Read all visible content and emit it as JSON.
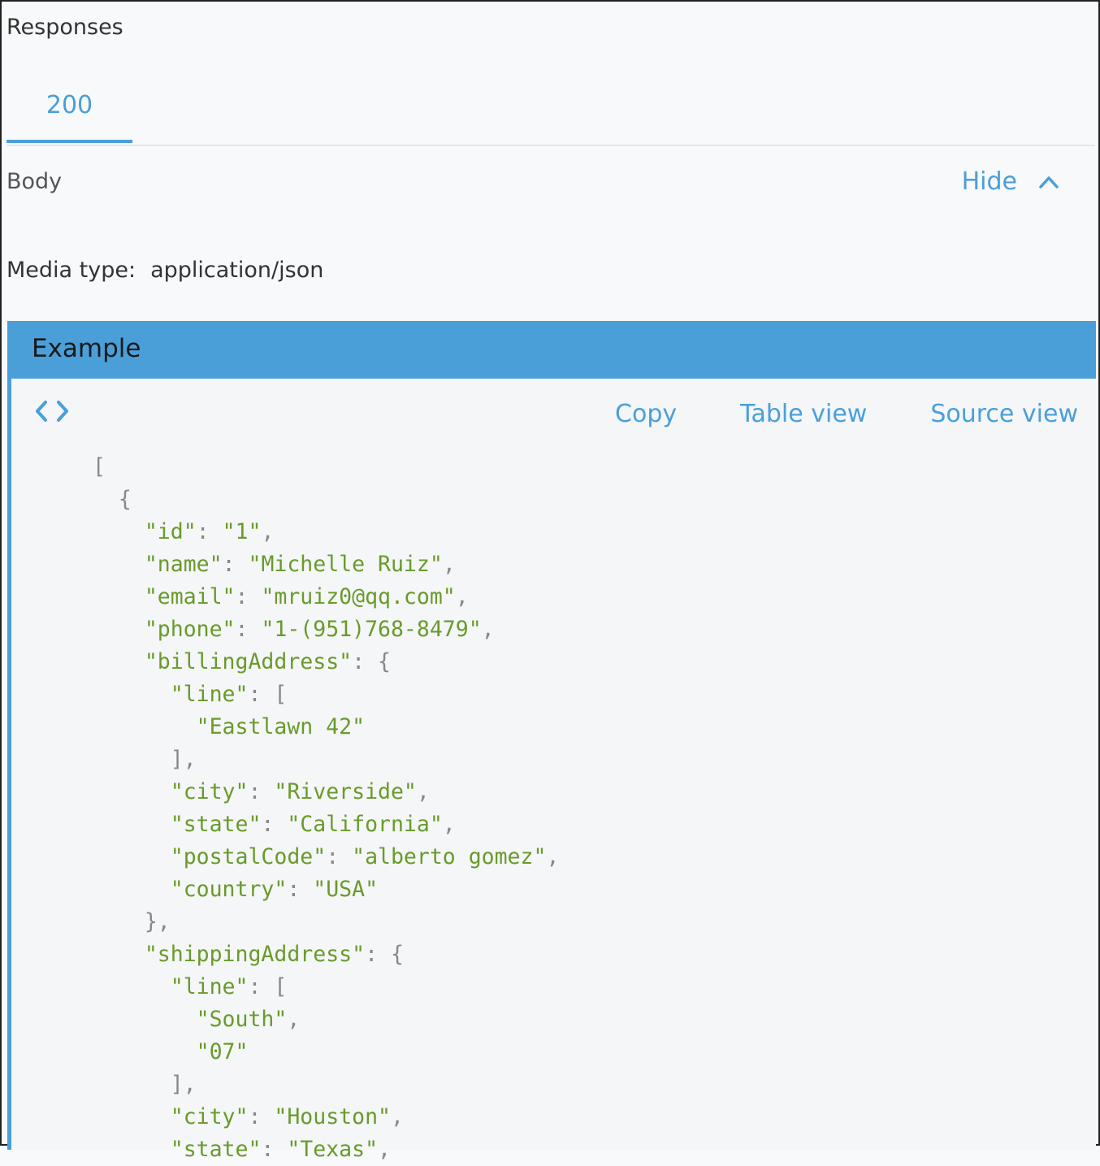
{
  "responses": {
    "title": "Responses",
    "tabs": [
      {
        "label": "200",
        "active": true
      }
    ]
  },
  "body": {
    "label": "Body",
    "toggle_label": "Hide",
    "media_type_label": "Media type:",
    "media_type_value": "application/json"
  },
  "example": {
    "title": "Example",
    "toolbar": {
      "copy": "Copy",
      "table_view": "Table view",
      "source_view": "Source view"
    },
    "code_lines": [
      [
        {
          "t": "[",
          "c": "punc"
        }
      ],
      [
        {
          "t": "  {",
          "c": "punc"
        }
      ],
      [
        {
          "t": "    ",
          "c": "punc"
        },
        {
          "t": "\"id\"",
          "c": "key"
        },
        {
          "t": ": ",
          "c": "punc"
        },
        {
          "t": "\"1\"",
          "c": "str"
        },
        {
          "t": ",",
          "c": "punc"
        }
      ],
      [
        {
          "t": "    ",
          "c": "punc"
        },
        {
          "t": "\"name\"",
          "c": "key"
        },
        {
          "t": ": ",
          "c": "punc"
        },
        {
          "t": "\"Michelle Ruiz\"",
          "c": "str"
        },
        {
          "t": ",",
          "c": "punc"
        }
      ],
      [
        {
          "t": "    ",
          "c": "punc"
        },
        {
          "t": "\"email\"",
          "c": "key"
        },
        {
          "t": ": ",
          "c": "punc"
        },
        {
          "t": "\"mruiz0@qq.com\"",
          "c": "str"
        },
        {
          "t": ",",
          "c": "punc"
        }
      ],
      [
        {
          "t": "    ",
          "c": "punc"
        },
        {
          "t": "\"phone\"",
          "c": "key"
        },
        {
          "t": ": ",
          "c": "punc"
        },
        {
          "t": "\"1-(951)768-8479\"",
          "c": "str"
        },
        {
          "t": ",",
          "c": "punc"
        }
      ],
      [
        {
          "t": "    ",
          "c": "punc"
        },
        {
          "t": "\"billingAddress\"",
          "c": "key"
        },
        {
          "t": ": {",
          "c": "punc"
        }
      ],
      [
        {
          "t": "      ",
          "c": "punc"
        },
        {
          "t": "\"line\"",
          "c": "key"
        },
        {
          "t": ": [",
          "c": "punc"
        }
      ],
      [
        {
          "t": "        ",
          "c": "punc"
        },
        {
          "t": "\"Eastlawn 42\"",
          "c": "str"
        }
      ],
      [
        {
          "t": "      ],",
          "c": "punc"
        }
      ],
      [
        {
          "t": "      ",
          "c": "punc"
        },
        {
          "t": "\"city\"",
          "c": "key"
        },
        {
          "t": ": ",
          "c": "punc"
        },
        {
          "t": "\"Riverside\"",
          "c": "str"
        },
        {
          "t": ",",
          "c": "punc"
        }
      ],
      [
        {
          "t": "      ",
          "c": "punc"
        },
        {
          "t": "\"state\"",
          "c": "key"
        },
        {
          "t": ": ",
          "c": "punc"
        },
        {
          "t": "\"California\"",
          "c": "str"
        },
        {
          "t": ",",
          "c": "punc"
        }
      ],
      [
        {
          "t": "      ",
          "c": "punc"
        },
        {
          "t": "\"postalCode\"",
          "c": "key"
        },
        {
          "t": ": ",
          "c": "punc"
        },
        {
          "t": "\"alberto gomez\"",
          "c": "str"
        },
        {
          "t": ",",
          "c": "punc"
        }
      ],
      [
        {
          "t": "      ",
          "c": "punc"
        },
        {
          "t": "\"country\"",
          "c": "key"
        },
        {
          "t": ": ",
          "c": "punc"
        },
        {
          "t": "\"USA\"",
          "c": "str"
        }
      ],
      [
        {
          "t": "    },",
          "c": "punc"
        }
      ],
      [
        {
          "t": "    ",
          "c": "punc"
        },
        {
          "t": "\"shippingAddress\"",
          "c": "key"
        },
        {
          "t": ": {",
          "c": "punc"
        }
      ],
      [
        {
          "t": "      ",
          "c": "punc"
        },
        {
          "t": "\"line\"",
          "c": "key"
        },
        {
          "t": ": [",
          "c": "punc"
        }
      ],
      [
        {
          "t": "        ",
          "c": "punc"
        },
        {
          "t": "\"South\"",
          "c": "str"
        },
        {
          "t": ",",
          "c": "punc"
        }
      ],
      [
        {
          "t": "        ",
          "c": "punc"
        },
        {
          "t": "\"07\"",
          "c": "str"
        }
      ],
      [
        {
          "t": "      ],",
          "c": "punc"
        }
      ],
      [
        {
          "t": "      ",
          "c": "punc"
        },
        {
          "t": "\"city\"",
          "c": "key"
        },
        {
          "t": ": ",
          "c": "punc"
        },
        {
          "t": "\"Houston\"",
          "c": "str"
        },
        {
          "t": ",",
          "c": "punc"
        }
      ],
      [
        {
          "t": "      ",
          "c": "punc"
        },
        {
          "t": "\"state\"",
          "c": "key"
        },
        {
          "t": ": ",
          "c": "punc"
        },
        {
          "t": "\"Texas\"",
          "c": "str"
        },
        {
          "t": ",",
          "c": "punc"
        }
      ]
    ]
  },
  "colors": {
    "accent": "#4a9fd9",
    "json_value": "#6a9a2a",
    "json_punctuation": "#888888"
  },
  "icons": {
    "toggle": "chevron-up-icon",
    "code": "code-brackets-icon"
  }
}
